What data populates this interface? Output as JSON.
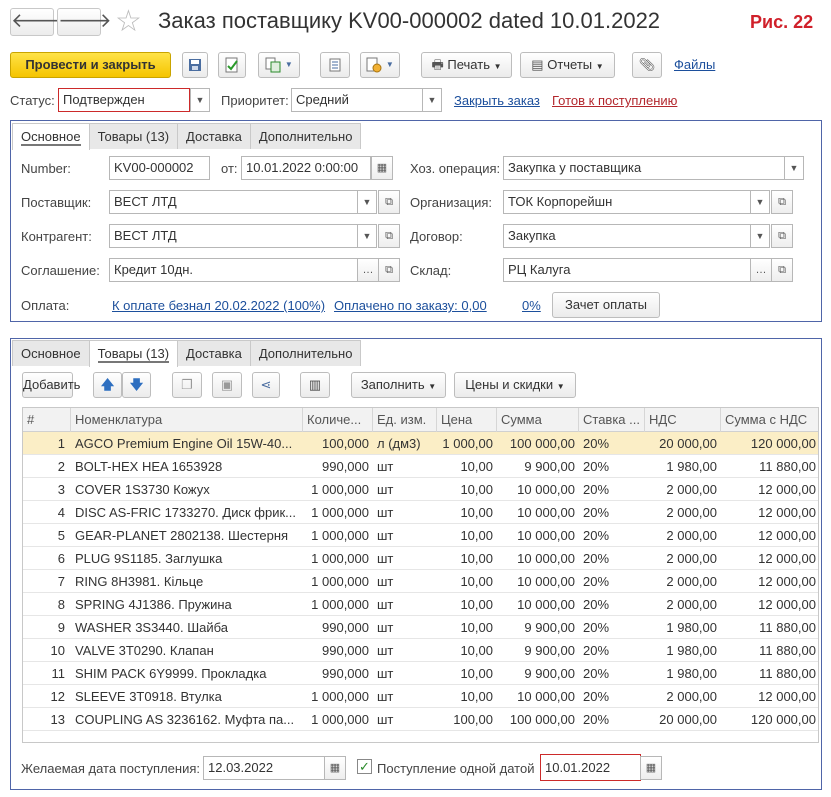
{
  "header": {
    "title": "Заказ поставщику KV00-000002 dated 10.01.2022",
    "fig_label": "Рис. 22",
    "back_glyph": "🡐",
    "forward_glyph": "🡒",
    "star_glyph": "☆"
  },
  "toolbar": {
    "post_close": "Провести и закрыть",
    "print": "Печать",
    "reports": "Отчеты",
    "files": "Файлы"
  },
  "status_row": {
    "status_label": "Статус:",
    "status_value": "Подтвержден",
    "priority_label": "Приоритет:",
    "priority_value": "Средний",
    "close_order": "Закрыть заказ",
    "ready_receipt": "Готов к поступлению"
  },
  "top_tabs": [
    "Основное",
    "Товары (13)",
    "Доставка",
    "Дополнительно"
  ],
  "main_form": {
    "number_label": "Number:",
    "number_value": "KV00-000002",
    "from_label": "от:",
    "date_value": "10.01.2022  0:00:00",
    "operation_label": "Хоз. операция:",
    "operation_value": "Закупка у поставщика",
    "supplier_label": "Поставщик:",
    "supplier_value": "ВЕСТ ЛТД",
    "org_label": "Организация:",
    "org_value": "ТОК Корпорейшн",
    "contractor_label": "Контрагент:",
    "contractor_value": "ВЕСТ ЛТД",
    "contract_label": "Договор:",
    "contract_value": "Закупка",
    "agreement_label": "Соглашение:",
    "agreement_value": "Кредит 10дн.",
    "warehouse_label": "Склад:",
    "warehouse_value": "РЦ Калуга",
    "payment_label": "Оплата:",
    "payment_link": "К оплате безнал 20.02.2022 (100%)",
    "paid_link": "Оплачено по заказу: 0,00",
    "paid_pct": "0%",
    "offset_button": "Зачет оплаты"
  },
  "goods_tabs": [
    "Основное",
    "Товары (13)",
    "Доставка",
    "Дополнительно"
  ],
  "goods_toolbar": {
    "add": "Добавить",
    "fill": "Заполнить",
    "prices": "Цены и скидки"
  },
  "table": {
    "columns": [
      "#",
      "Номенклатура",
      "Количе...",
      "Ед. изм.",
      "Цена",
      "Сумма",
      "Ставка ...",
      "НДС",
      "Сумма с НДС"
    ],
    "rows": [
      [
        "1",
        "AGCO Premium Engine Oil 15W-40...",
        "100,000",
        "л (дм3)",
        "1 000,00",
        "100 000,00",
        "20%",
        "20 000,00",
        "120 000,00"
      ],
      [
        "2",
        "BOLT-HEX HEA 1653928",
        "990,000",
        "шт",
        "10,00",
        "9 900,00",
        "20%",
        "1 980,00",
        "11 880,00"
      ],
      [
        "3",
        "COVER 1S3730 Кожух",
        "1 000,000",
        "шт",
        "10,00",
        "10 000,00",
        "20%",
        "2 000,00",
        "12 000,00"
      ],
      [
        "4",
        "DISC AS-FRIC 1733270. Диск фрик...",
        "1 000,000",
        "шт",
        "10,00",
        "10 000,00",
        "20%",
        "2 000,00",
        "12 000,00"
      ],
      [
        "5",
        "GEAR-PLANET 2802138. Шестерня",
        "1 000,000",
        "шт",
        "10,00",
        "10 000,00",
        "20%",
        "2 000,00",
        "12 000,00"
      ],
      [
        "6",
        "PLUG 9S1185. Заглушка",
        "1 000,000",
        "шт",
        "10,00",
        "10 000,00",
        "20%",
        "2 000,00",
        "12 000,00"
      ],
      [
        "7",
        "RING 8H3981. Кільце",
        "1 000,000",
        "шт",
        "10,00",
        "10 000,00",
        "20%",
        "2 000,00",
        "12 000,00"
      ],
      [
        "8",
        "SPRING 4J1386. Пружина",
        "1 000,000",
        "шт",
        "10,00",
        "10 000,00",
        "20%",
        "2 000,00",
        "12 000,00"
      ],
      [
        "9",
        "WASHER 3S3440. Шайба",
        "990,000",
        "шт",
        "10,00",
        "9 900,00",
        "20%",
        "1 980,00",
        "11 880,00"
      ],
      [
        "10",
        "VALVE 3T0290. Клапан",
        "990,000",
        "шт",
        "10,00",
        "9 900,00",
        "20%",
        "1 980,00",
        "11 880,00"
      ],
      [
        "11",
        "SHIM PACK 6Y9999. Прокладка",
        "990,000",
        "шт",
        "10,00",
        "9 900,00",
        "20%",
        "1 980,00",
        "11 880,00"
      ],
      [
        "12",
        "SLEEVE 3T0918. Втулка",
        "1 000,000",
        "шт",
        "10,00",
        "10 000,00",
        "20%",
        "2 000,00",
        "12 000,00"
      ],
      [
        "13",
        "COUPLING AS 3236162. Муфта па...",
        "1 000,000",
        "шт",
        "100,00",
        "100 000,00",
        "20%",
        "20 000,00",
        "120 000,00"
      ]
    ],
    "selected_row": 0
  },
  "footer": {
    "desired_date_label": "Желаемая дата поступления:",
    "desired_date_value": "12.03.2022",
    "single_date_label": "Поступление одной датой",
    "single_date_value": "10.01.2022",
    "single_date_checked": true
  }
}
